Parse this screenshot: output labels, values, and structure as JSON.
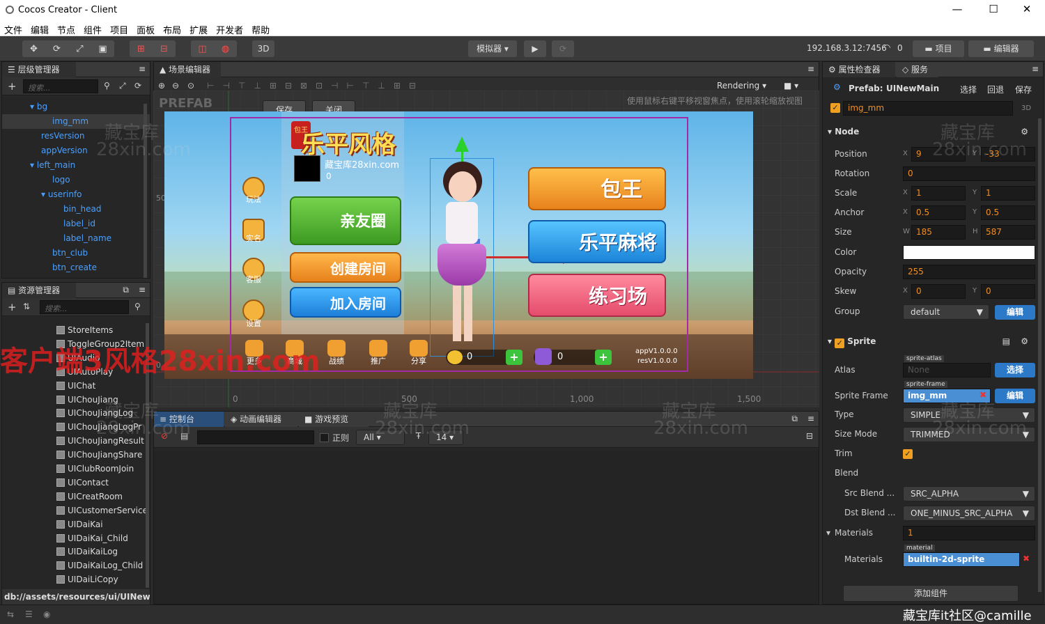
{
  "window": {
    "title": "Cocos Creator - Client",
    "min": "—",
    "max": "☐",
    "close": "✕"
  },
  "menu": [
    "文件",
    "编辑",
    "节点",
    "组件",
    "项目",
    "面板",
    "布局",
    "扩展",
    "开发者",
    "帮助"
  ],
  "toolbar": {
    "btn_3d": "3D",
    "simulator": "模拟器 ▾",
    "play": "▶",
    "refresh": "⟳",
    "ip": "192.168.3.12:7456",
    "wifi_count": "0",
    "project_btn": "项目",
    "editor_btn": "编辑器"
  },
  "hierarchy": {
    "title": "层级管理器",
    "search_placeholder": "搜索...",
    "items": [
      {
        "label": "▾ bg"
      },
      {
        "label": "img_mm"
      },
      {
        "label": "resVersion"
      },
      {
        "label": "appVersion"
      },
      {
        "label": "▾ left_main"
      },
      {
        "label": "logo"
      },
      {
        "label": "▾ userinfo"
      },
      {
        "label": "bin_head"
      },
      {
        "label": "label_id"
      },
      {
        "label": "label_name"
      },
      {
        "label": "btn_club"
      },
      {
        "label": "btn_create"
      }
    ]
  },
  "assets": {
    "title": "资源管理器",
    "search_placeholder": "搜索...",
    "items": [
      "StoreItems",
      "ToggleGroup2Item",
      "UIAudio",
      "UIAutoPlay",
      "UIChat",
      "UIChouJiang",
      "UIChouJiangLog",
      "UIChouJiangLogPr",
      "UIChouJiangResult",
      "UIChouJiangShare",
      "UIClubRoomJoin",
      "UIContact",
      "UICreatRoom",
      "UICustomerService",
      "UIDaiKai",
      "UIDaiKai_Child",
      "UIDaiKaiLog",
      "UIDaiKaiLog_Child",
      "UIDaiLiCopy"
    ],
    "path": "db://assets/resources/ui/UINew..."
  },
  "scene": {
    "title": "场景编辑器",
    "rendering": "Rendering",
    "prefab_label": "PREFAB",
    "save": "保存",
    "close": "关闭",
    "hint": "使用鼠标右键平移视窗焦点，使用滚轮缩放视图",
    "ruler_x": [
      "0",
      "500",
      "1,000",
      "1,500"
    ],
    "ruler_y": [
      "500",
      "0"
    ]
  },
  "game": {
    "logo_text": "乐平风格",
    "logo_badge": "包王",
    "username": "藏宝库28xin.com",
    "user_id": "0",
    "btn_friends": "亲友圈",
    "btn_create": "创建房间",
    "btn_join": "加入房间",
    "btn_baowang": "包王",
    "btn_mahjong": "乐平麻将",
    "btn_practice": "练习场",
    "side": [
      "玩法",
      "实名",
      "客服",
      "设置"
    ],
    "bottom": [
      "更多",
      "商城",
      "战绩",
      "推广",
      "分享"
    ],
    "coins": "0",
    "gems": "0",
    "app_version": "appV1.0.0.0",
    "res_version": "resV1.0.0.0"
  },
  "console": {
    "tabs": [
      "控制台",
      "动画编辑器",
      "游戏预览"
    ],
    "regex_label": "正则",
    "filter": "All",
    "font_size": "14"
  },
  "inspector": {
    "tabs": [
      "属性检查器",
      "服务"
    ],
    "prefab_label": "Prefab:",
    "prefab_name": "UINewMain",
    "select": "选择",
    "revert": "回退",
    "save": "保存",
    "node_name": "img_mm",
    "tag_3d": "3D",
    "node_section": "Node",
    "position": {
      "label": "Position",
      "x": "9",
      "y": "-33"
    },
    "rotation": {
      "label": "Rotation",
      "v": "0"
    },
    "scale": {
      "label": "Scale",
      "x": "1",
      "y": "1"
    },
    "anchor": {
      "label": "Anchor",
      "x": "0.5",
      "y": "0.5"
    },
    "size": {
      "label": "Size",
      "w": "185",
      "h": "587"
    },
    "color_label": "Color",
    "opacity": {
      "label": "Opacity",
      "v": "255"
    },
    "skew": {
      "label": "Skew",
      "x": "0",
      "y": "0"
    },
    "group": {
      "label": "Group",
      "v": "default",
      "btn": "编辑"
    },
    "sprite_section": "Sprite",
    "atlas": {
      "label": "Atlas",
      "tag": "sprite-atlas",
      "v": "None",
      "btn": "选择"
    },
    "sprite_frame": {
      "label": "Sprite Frame",
      "tag": "sprite-frame",
      "v": "img_mm",
      "btn": "编辑"
    },
    "type": {
      "label": "Type",
      "v": "SIMPLE"
    },
    "size_mode": {
      "label": "Size Mode",
      "v": "TRIMMED"
    },
    "trim_label": "Trim",
    "blend_label": "Blend",
    "src_blend": {
      "label": "Src Blend ...",
      "v": "SRC_ALPHA"
    },
    "dst_blend": {
      "label": "Dst Blend ...",
      "v": "ONE_MINUS_SRC_ALPHA"
    },
    "materials_section": {
      "label": "Materials",
      "v": "1"
    },
    "materials": {
      "label": "Materials",
      "tag": "material",
      "v": "builtin-2d-sprite"
    },
    "add_component": "添加组件",
    "xy": {
      "x": "X",
      "y": "Y",
      "w": "W",
      "h": "H"
    }
  },
  "watermarks": [
    "藏宝库",
    "28xin.com",
    "客户端3风格28xin.com",
    "藏宝库it社区@camille"
  ],
  "colors": {
    "accent_blue": "#2b79c7",
    "field_orange": "#f08e26",
    "tree_blue": "#4aa0ff"
  }
}
